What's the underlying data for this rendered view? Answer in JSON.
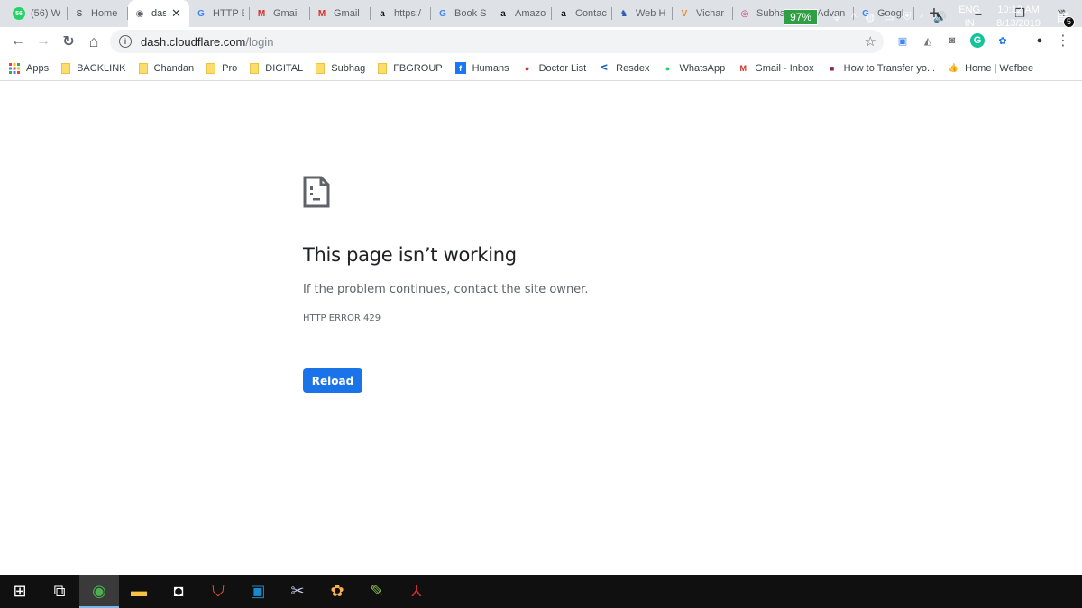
{
  "tabs": [
    {
      "label": "(56) W",
      "icon": "whatsapp-icon",
      "icon_glyph": "56",
      "icon_color": "#25d366",
      "active": false
    },
    {
      "label": "Home",
      "icon": "s-site-icon",
      "icon_glyph": "S",
      "icon_color": "#5f6368",
      "active": false
    },
    {
      "label": "das",
      "icon": "globe-icon",
      "icon_glyph": "◉",
      "icon_color": "#5f6368",
      "active": true
    },
    {
      "label": "HTTP E",
      "icon": "google-icon",
      "icon_glyph": "G",
      "icon_color": "#4285f4",
      "active": false
    },
    {
      "label": "Gmail",
      "icon": "gmail-icon",
      "icon_glyph": "M",
      "icon_color": "#d93025",
      "active": false
    },
    {
      "label": "Gmail",
      "icon": "gmail-icon",
      "icon_glyph": "M",
      "icon_color": "#d93025",
      "active": false
    },
    {
      "label": "https:/",
      "icon": "amazon-icon",
      "icon_glyph": "a",
      "icon_color": "#111111",
      "active": false
    },
    {
      "label": "Book S",
      "icon": "google-icon",
      "icon_glyph": "G",
      "icon_color": "#4285f4",
      "active": false
    },
    {
      "label": "Amazo",
      "icon": "amazon-icon",
      "icon_glyph": "a",
      "icon_color": "#111111",
      "active": false
    },
    {
      "label": "Contac",
      "icon": "amazon-icon",
      "icon_glyph": "a",
      "icon_color": "#111111",
      "active": false
    },
    {
      "label": "Web H",
      "icon": "webhost-icon",
      "icon_glyph": "♞",
      "icon_color": "#2a5db0",
      "active": false
    },
    {
      "label": "Vichar",
      "icon": "vichar-icon",
      "icon_glyph": "V",
      "icon_color": "#f0892b",
      "active": false
    },
    {
      "label": "Subha",
      "icon": "instagram-icon",
      "icon_glyph": "◎",
      "icon_color": "#c13584",
      "active": false
    },
    {
      "label": "Advan",
      "icon": "avatar-face-icon",
      "icon_glyph": "☺",
      "icon_color": "#a0704a",
      "active": false
    },
    {
      "label": "Googl",
      "icon": "google-icon",
      "icon_glyph": "G",
      "icon_color": "#4285f4",
      "active": false
    }
  ],
  "active_tab_close": "✕",
  "new_tab": "+",
  "window_controls": {
    "minimize": "–",
    "restore": "❐",
    "close": "✕"
  },
  "toolbar": {
    "back": "←",
    "forward": "→",
    "reload": "↻",
    "home": "⌂",
    "info": "i",
    "url_host": "dash.cloudflare.com",
    "url_path": "/login",
    "star": "☆",
    "menu": "⋮"
  },
  "extensions": [
    {
      "name": "bookmark-ext-icon",
      "glyph": "▣",
      "color": "#4285f4"
    },
    {
      "name": "cleaner-ext-icon",
      "glyph": "◭",
      "color": "#777777"
    },
    {
      "name": "camera-ext-icon",
      "glyph": "◙",
      "color": "#777777"
    },
    {
      "name": "grammarly-icon",
      "glyph": "G",
      "color": "#15c39a"
    },
    {
      "name": "flower-ext-icon",
      "glyph": "✿",
      "color": "#1a73e8"
    },
    {
      "name": "profile-avatar-icon",
      "glyph": "●",
      "color": "#333333"
    }
  ],
  "bookmarks": [
    {
      "label": "Apps",
      "icon": "apps-grid-icon",
      "type": "apps"
    },
    {
      "label": "BACKLINK",
      "icon": "folder-icon",
      "type": "folder"
    },
    {
      "label": "Chandan",
      "icon": "folder-icon",
      "type": "folder"
    },
    {
      "label": "Pro",
      "icon": "folder-icon",
      "type": "folder"
    },
    {
      "label": "DIGITAL",
      "icon": "folder-icon",
      "type": "folder"
    },
    {
      "label": "Subhag",
      "icon": "folder-icon",
      "type": "folder"
    },
    {
      "label": "FBGROUP",
      "icon": "folder-icon",
      "type": "folder"
    },
    {
      "label": "Humans",
      "icon": "facebook-icon",
      "type": "site",
      "glyph": "f",
      "color": "#1877f2"
    },
    {
      "label": "Doctor List",
      "icon": "map-pin-icon",
      "type": "site",
      "glyph": "●",
      "color": "#d32f2f"
    },
    {
      "label": "Resdex",
      "icon": "resdex-icon",
      "type": "site",
      "glyph": "ᐸ",
      "color": "#1a5fb4"
    },
    {
      "label": "WhatsApp",
      "icon": "whatsapp-icon",
      "type": "site",
      "glyph": "●",
      "color": "#25d366"
    },
    {
      "label": "Gmail - Inbox",
      "icon": "gmail-icon",
      "type": "site",
      "glyph": "M",
      "color": "#d93025"
    },
    {
      "label": "How to Transfer yo...",
      "icon": "colored-squares-icon",
      "type": "site",
      "glyph": "■",
      "color": "#8e1e5b"
    },
    {
      "label": "Home | Wefbee",
      "icon": "thumbs-up-icon",
      "type": "site",
      "glyph": "👍",
      "color": "#2a5db0"
    }
  ],
  "bookmarks_more": "»",
  "error_page": {
    "title": "This page isn’t working",
    "description": "If the problem continues, contact the site owner.",
    "error_code": "HTTP ERROR 429",
    "reload_label": "Reload"
  },
  "taskbar": {
    "apps": [
      {
        "name": "start-windows-icon",
        "glyph": "⊞",
        "color": "#ffffff",
        "active": false
      },
      {
        "name": "task-view-icon",
        "glyph": "⧉",
        "color": "#ffffff",
        "active": false
      },
      {
        "name": "chrome-icon",
        "glyph": "◉",
        "color": "#4caf50",
        "active": true
      },
      {
        "name": "file-explorer-icon",
        "glyph": "▬",
        "color": "#f6c343",
        "active": false
      },
      {
        "name": "camera-app-icon",
        "glyph": "◘",
        "color": "#ffffff",
        "active": false
      },
      {
        "name": "brave-icon",
        "glyph": "⛉",
        "color": "#fb542b",
        "active": false
      },
      {
        "name": "connect-app-icon",
        "glyph": "▣",
        "color": "#1e88c8",
        "active": false
      },
      {
        "name": "snipping-tool-icon",
        "glyph": "✂",
        "color": "#c9c9e8",
        "active": false
      },
      {
        "name": "flower-app-icon",
        "glyph": "✿",
        "color": "#f7b34f",
        "active": false
      },
      {
        "name": "pen-app-icon",
        "glyph": "✎",
        "color": "#8bc34a",
        "active": false
      },
      {
        "name": "acrobat-icon",
        "glyph": "⅄",
        "color": "#d32f2f",
        "active": false
      }
    ],
    "battery_percent": "97%",
    "tray_icons": [
      {
        "name": "power-plug-icon",
        "glyph": "⏚"
      },
      {
        "name": "show-hidden-icons-chevron",
        "glyph": "^"
      },
      {
        "name": "network-globe-icon",
        "glyph": "◍"
      },
      {
        "name": "battery-status-icon",
        "glyph": "▭"
      },
      {
        "name": "security-shield-icon",
        "glyph": "⛨"
      },
      {
        "name": "wifi-icon",
        "glyph": "◜"
      },
      {
        "name": "volume-icon",
        "glyph": "🔊"
      }
    ],
    "language_line1": "ENG",
    "language_line2": "IN",
    "time": "10:12 AM",
    "date": "8/13/2019",
    "notification_count": "5"
  }
}
